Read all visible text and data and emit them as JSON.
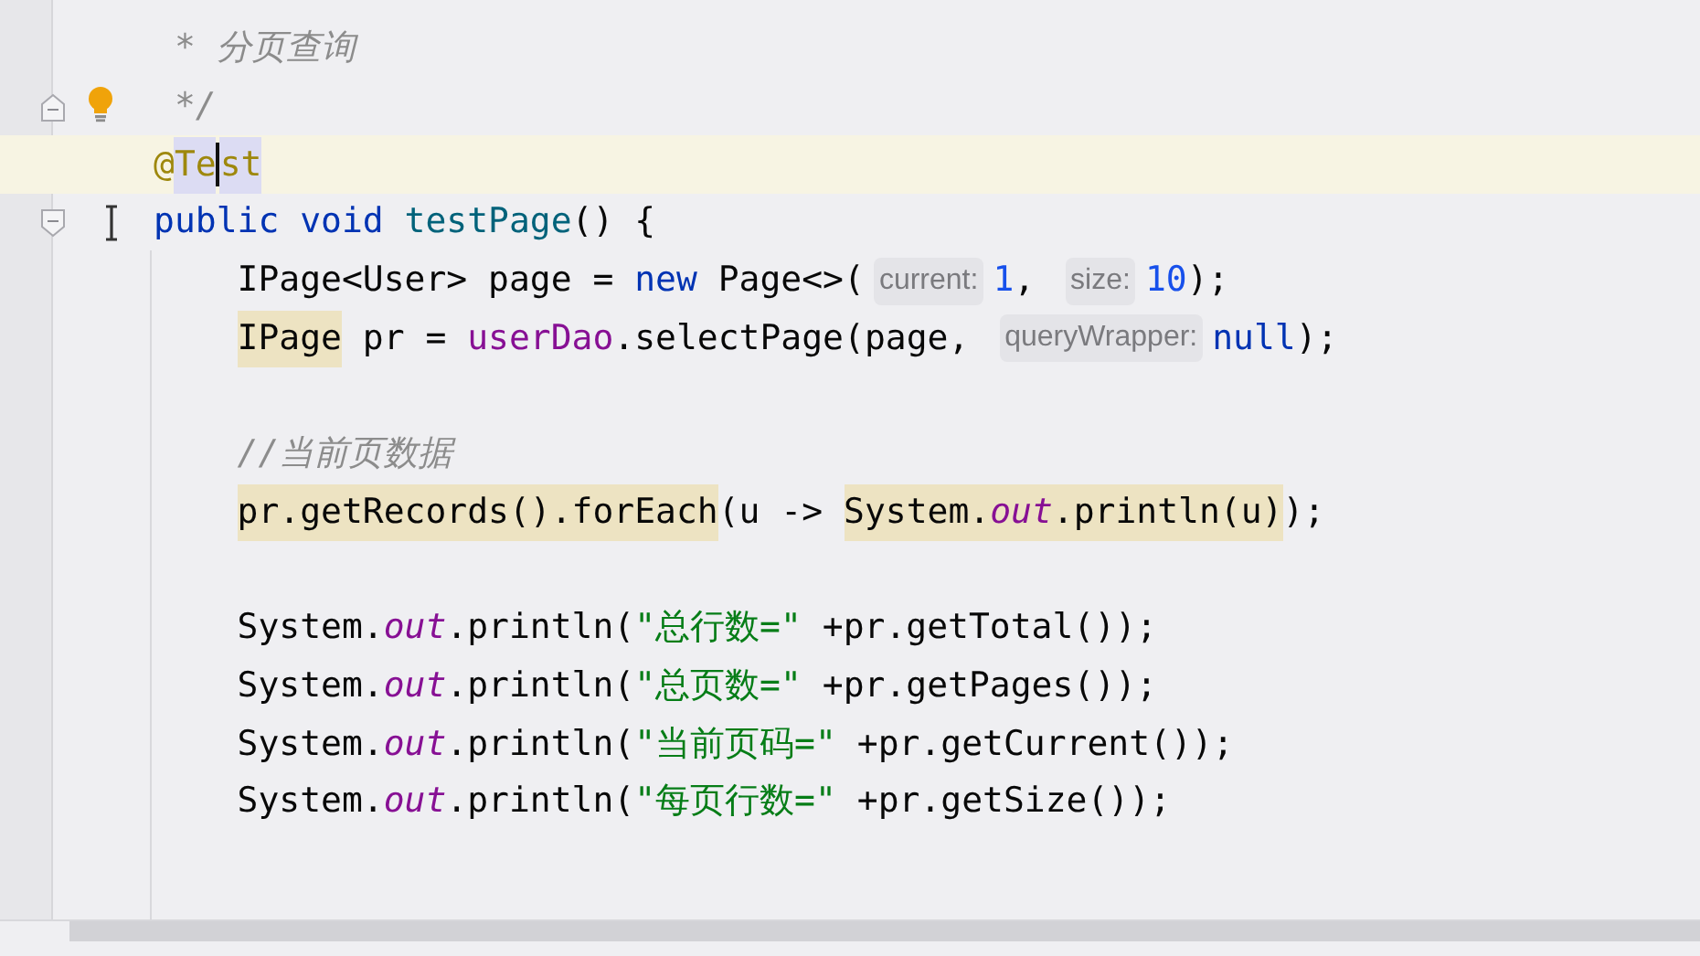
{
  "editor": {
    "lines": [
      {
        "kind": "code",
        "current": false,
        "tokens": [
          {
            "text": " * ",
            "kind": "comment"
          },
          {
            "text": "分页查询",
            "kind": "comment"
          }
        ]
      },
      {
        "kind": "code",
        "current": false,
        "gutter_icons": [
          {
            "kind": "fold_end"
          },
          {
            "kind": "bulb"
          }
        ],
        "tokens": [
          {
            "text": " */",
            "kind": "comment"
          }
        ]
      },
      {
        "kind": "code",
        "current": true,
        "tokens": [
          {
            "text": "@",
            "kind": "annotation"
          },
          {
            "text": "Te",
            "kind": "annotation",
            "highlighted": true,
            "caret": true
          },
          {
            "text": "st",
            "kind": "annotation",
            "highlighted": true
          }
        ]
      },
      {
        "kind": "code",
        "current": false,
        "gutter_icons": [
          {
            "kind": "fold_start"
          }
        ],
        "tokens": [
          {
            "text": "public ",
            "kind": "keyword"
          },
          {
            "text": "void ",
            "kind": "keyword"
          },
          {
            "text": "testPage",
            "kind": "method"
          },
          {
            "text": "() {",
            "kind": "plain"
          }
        ],
        "children": [
          {
            "kind": "code",
            "current": false,
            "tokens": [
              {
                "text": "IPage<User> page = ",
                "kind": "plain"
              },
              {
                "text": "new",
                "kind": "keyword"
              },
              {
                "text": " Page<>(",
                "kind": "plain"
              },
              {
                "text": "current:",
                "kind": "hint"
              },
              {
                "text": "1",
                "kind": "number"
              },
              {
                "text": ", ",
                "kind": "plain"
              },
              {
                "text": "size:",
                "kind": "hint"
              },
              {
                "text": "10",
                "kind": "number"
              },
              {
                "text": ");",
                "kind": "plain"
              }
            ]
          },
          {
            "kind": "code",
            "current": false,
            "tokens": [
              {
                "text": "IPage",
                "kind": "plain",
                "highlighted": true
              },
              {
                "text": " pr = ",
                "kind": "plain"
              },
              {
                "text": "userDao",
                "kind": "field"
              },
              {
                "text": ".selectPage(page, ",
                "kind": "plain"
              },
              {
                "text": "queryWrapper:",
                "kind": "hint"
              },
              {
                "text": "null",
                "kind": "keyword"
              },
              {
                "text": ");",
                "kind": "plain"
              }
            ]
          },
          {
            "kind": "blank",
            "current": false
          },
          {
            "kind": "code",
            "current": false,
            "tokens": [
              {
                "text": "//当前页数据",
                "kind": "comment"
              }
            ]
          },
          {
            "kind": "code",
            "current": false,
            "tokens": [
              {
                "text": "pr.getRecords().forEach",
                "kind": "plain",
                "highlighted": true
              },
              {
                "text": "(u -> ",
                "kind": "plain"
              },
              {
                "text": "System.",
                "kind": "plain",
                "highlighted": true
              },
              {
                "text": "out",
                "kind": "static",
                "highlighted": true
              },
              {
                "text": ".println(u)",
                "kind": "plain",
                "highlighted": true
              },
              {
                "text": ");",
                "kind": "plain"
              }
            ]
          },
          {
            "kind": "blank",
            "current": false
          },
          {
            "kind": "code",
            "current": false,
            "tokens": [
              {
                "text": "System.",
                "kind": "plain"
              },
              {
                "text": "out",
                "kind": "static"
              },
              {
                "text": ".println(",
                "kind": "plain"
              },
              {
                "text": "\"总行数=\"",
                "kind": "string"
              },
              {
                "text": " +pr.getTotal());",
                "kind": "plain"
              }
            ]
          },
          {
            "kind": "code",
            "current": false,
            "tokens": [
              {
                "text": "System.",
                "kind": "plain"
              },
              {
                "text": "out",
                "kind": "static"
              },
              {
                "text": ".println(",
                "kind": "plain"
              },
              {
                "text": "\"总页数=\"",
                "kind": "string"
              },
              {
                "text": " +pr.getPages());",
                "kind": "plain"
              }
            ]
          },
          {
            "kind": "code",
            "current": false,
            "tokens": [
              {
                "text": "System.",
                "kind": "plain"
              },
              {
                "text": "out",
                "kind": "static"
              },
              {
                "text": ".println(",
                "kind": "plain"
              },
              {
                "text": "\"当前页码=\"",
                "kind": "string"
              },
              {
                "text": " +pr.getCurrent());",
                "kind": "plain"
              }
            ]
          },
          {
            "kind": "code",
            "current": false,
            "tokens": [
              {
                "text": "System.",
                "kind": "plain"
              },
              {
                "text": "out",
                "kind": "static"
              },
              {
                "text": ".println(",
                "kind": "plain"
              },
              {
                "text": "\"每页行数=\"",
                "kind": "string"
              },
              {
                "text": " +pr.getSize());",
                "kind": "plain"
              }
            ]
          },
          {
            "kind": "blank",
            "current": false
          }
        ]
      }
    ]
  }
}
